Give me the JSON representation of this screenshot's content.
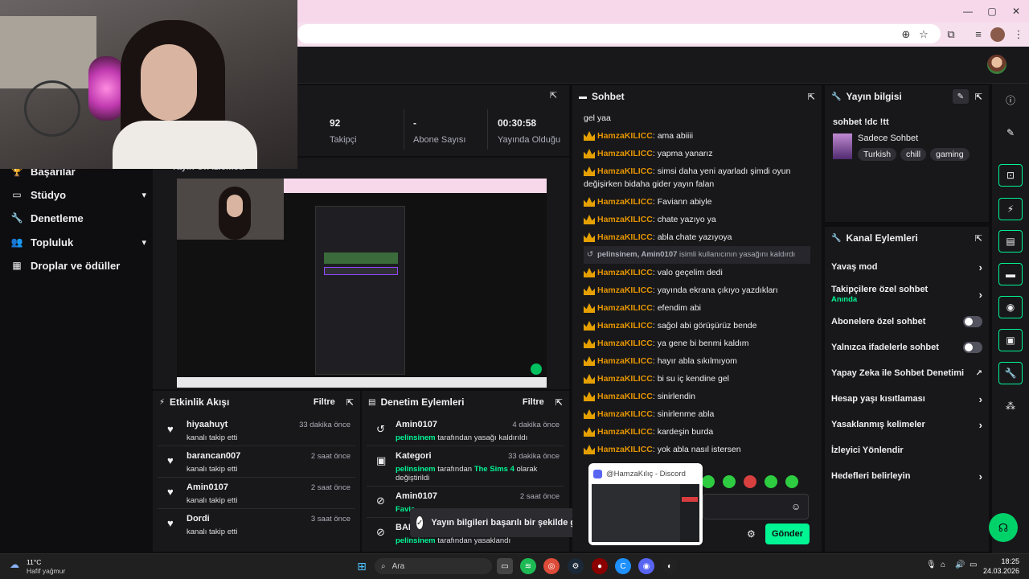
{
  "stats": {
    "followers": {
      "value": "92",
      "label": "Takipçi"
    },
    "subs": {
      "value": "-",
      "label": "Abone Sayısı"
    },
    "uptime": {
      "value": "00:30:58",
      "label": "Yayında Olduğu"
    }
  },
  "preview_title": "Yayın Ön İzlemesi",
  "nav": [
    {
      "label": "Başarılar",
      "icon": "trophy-icon"
    },
    {
      "label": "Stüdyo",
      "icon": "studio-icon"
    },
    {
      "label": "Denetleme",
      "icon": "wrench-icon"
    },
    {
      "label": "Topluluk",
      "icon": "community-icon"
    },
    {
      "label": "Droplar ve ödüller",
      "icon": "drops-icon"
    }
  ],
  "activity": {
    "title": "Etkinlik Akışı",
    "filter": "Filtre",
    "items": [
      {
        "name": "hiyaahuyt",
        "sub": "kanalı takip etti",
        "time": "33 dakika önce"
      },
      {
        "name": "barancan007",
        "sub": "kanalı takip etti",
        "time": "2 saat önce"
      },
      {
        "name": "Amin0107",
        "sub": "kanalı takip etti",
        "time": "2 saat önce"
      },
      {
        "name": "Dordi",
        "sub": "kanalı takip etti",
        "time": "3 saat önce"
      }
    ]
  },
  "modactions": {
    "title": "Denetim Eylemleri",
    "filter": "Filtre",
    "items": [
      {
        "name": "Amin0107",
        "actor": "pelinsinem",
        "text": "tarafından yasağı kaldırıldı",
        "time": "4 dakika önce"
      },
      {
        "name": "Kategori",
        "actor": "pelinsinem",
        "text": "tarafından",
        "highlight": "The Sims 4",
        "text2": "olarak",
        "line3": "değiştirildi",
        "time": "33 dakika önce"
      },
      {
        "name": "Amin0107",
        "actor": "Favia",
        "text": "",
        "time": "2 saat önce"
      },
      {
        "name": "BAKI",
        "actor": "pelinsinem",
        "text": "tarafından yasaklandı",
        "time": ""
      }
    ]
  },
  "toast": "Yayın bilgileri başarılı bir şekilde güncel",
  "chat": {
    "title": "Sohbet",
    "first_line": "gel yaa",
    "messages": [
      {
        "user": "HamzaKILICC",
        "text": "ama abiiii"
      },
      {
        "user": "HamzaKILICC",
        "text": "yapma yanarız"
      },
      {
        "user": "HamzaKILICC",
        "text": "simsi daha yeni ayarladı şimdi oyun"
      },
      {
        "user": "",
        "text": "değişirken bidaha gider yayın falan"
      },
      {
        "user": "HamzaKILICC",
        "text": "Faviann abiyle"
      },
      {
        "user": "HamzaKILICC",
        "text": "chate yazıyo ya"
      },
      {
        "user": "HamzaKILICC",
        "text": "abla chate yazıyoya"
      },
      {
        "user": "HamzaKILICC",
        "text": "valo geçelim dedi"
      },
      {
        "user": "HamzaKILICC",
        "text": "yayında ekrana çıkıyo yazdıkları"
      },
      {
        "user": "HamzaKILICC",
        "text": "efendim abi"
      },
      {
        "user": "HamzaKILICC",
        "text": "sağol abi görüşürüz bende"
      },
      {
        "user": "HamzaKILICC",
        "text": "ya gene bi benmi kaldım"
      },
      {
        "user": "HamzaKILICC",
        "text": "hayır abla sıkılmıyom"
      },
      {
        "user": "HamzaKILICC",
        "text": "bi su iç kendine gel"
      },
      {
        "user": "HamzaKILICC",
        "text": "sinirlendin"
      },
      {
        "user": "HamzaKILICC",
        "text": "sinirlenme abla"
      },
      {
        "user": "HamzaKILICC",
        "text": "kardeşin burda"
      },
      {
        "user": "HamzaKILICC",
        "text": "yok abla nasıl istersen"
      }
    ],
    "system": {
      "bold": "pelinsinem, Amin0107",
      "text": "isimli kullanıcının yasağını kaldırdı"
    },
    "send": "Gönder"
  },
  "discord_popup": "@HamzaKılıç - Discord",
  "info": {
    "title": "Yayın bilgisi",
    "stream_title": "sohbet !dc !tt",
    "category": "Sadece Sohbet",
    "tags": [
      "Turkish",
      "chill",
      "gaming"
    ]
  },
  "channel": {
    "title": "Kanal Eylemleri",
    "rows": [
      {
        "label": "Yavaş mod",
        "type": "chevron"
      },
      {
        "label": "Takipçilere özel sohbet",
        "sub": "Anında",
        "type": "chevron"
      },
      {
        "label": "Abonelere özel sohbet",
        "type": "toggle"
      },
      {
        "label": "Yalnızca ifadelerle sohbet",
        "type": "toggle"
      },
      {
        "label": "Yapay Zeka ile Sohbet Denetimi",
        "type": "external"
      },
      {
        "label": "Hesap yaşı kısıtlaması",
        "type": "chevron"
      },
      {
        "label": "Yasaklanmış kelimeler",
        "type": "chevron"
      },
      {
        "label": "İzleyici Yönlendir",
        "type": "none"
      },
      {
        "label": "Hedefleri belirleyin",
        "type": "chevron"
      }
    ]
  },
  "taskbar": {
    "weather_temp": "11°C",
    "weather_desc": "Hafif yağmur",
    "search": "Ara",
    "time": "18:25",
    "date": "24.03.2026"
  },
  "colors": {
    "accent": "#00f593",
    "crown": "#e5a000",
    "bg": "#0e0e10",
    "panel": "#18181b"
  }
}
